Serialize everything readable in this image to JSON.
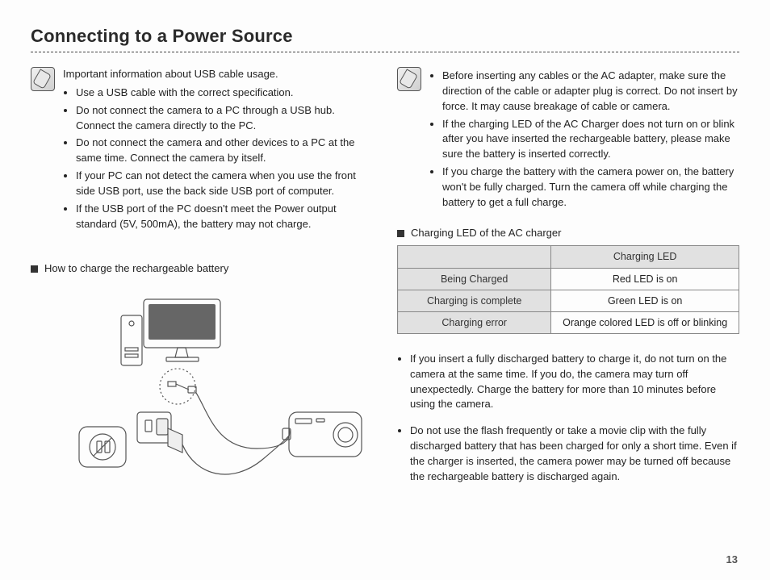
{
  "title": "Connecting to a Power Source",
  "page_number": "13",
  "left": {
    "note_intro": "Important information about USB cable usage.",
    "note_bullets": [
      "Use a USB cable with the correct specification.",
      "Do not connect the camera to a PC through a USB hub. Connect the camera directly to the PC.",
      "Do not connect the camera and other devices to a PC at the same time. Connect the camera by itself.",
      "If your PC can not detect the camera when you use the front side USB port, use the back side USB port of computer.",
      "If the USB port of the PC doesn't meet the Power output standard (5V, 500mA), the battery may not charge."
    ],
    "how_to_heading": "How to charge the rechargeable battery"
  },
  "right": {
    "note_bullets": [
      "Before inserting any cables or the AC adapter, make sure the direction of the cable or adapter plug is correct. Do not insert by force. It may cause breakage of cable or camera.",
      "If the charging LED of the AC Charger does not turn on or blink after you have inserted the rechargeable battery, please make sure the battery is inserted correctly.",
      "If you charge the battery with the camera power on, the battery won't be fully charged. Turn the camera off while charging the battery to get a full charge."
    ],
    "led_heading": "Charging LED of the AC charger",
    "after_bullets": [
      "If you insert a fully discharged battery to charge it, do not turn on the camera at the same time. If you do, the camera may turn off unexpectedly. Charge the battery for more than 10 minutes before using the camera.",
      "Do not use the flash frequently or take a movie clip with the fully discharged battery that has been charged for only a short time. Even if the charger is inserted, the camera power may be turned off because the rechargeable battery is discharged again."
    ]
  },
  "chart_data": {
    "type": "table",
    "title": "Charging LED of the AC charger",
    "columns": [
      "",
      "Charging LED"
    ],
    "rows": [
      {
        "label": "Being Charged",
        "value": "Red LED is on"
      },
      {
        "label": "Charging is complete",
        "value": "Green LED is on"
      },
      {
        "label": "Charging error",
        "value": "Orange colored LED is off or blinking"
      }
    ]
  }
}
